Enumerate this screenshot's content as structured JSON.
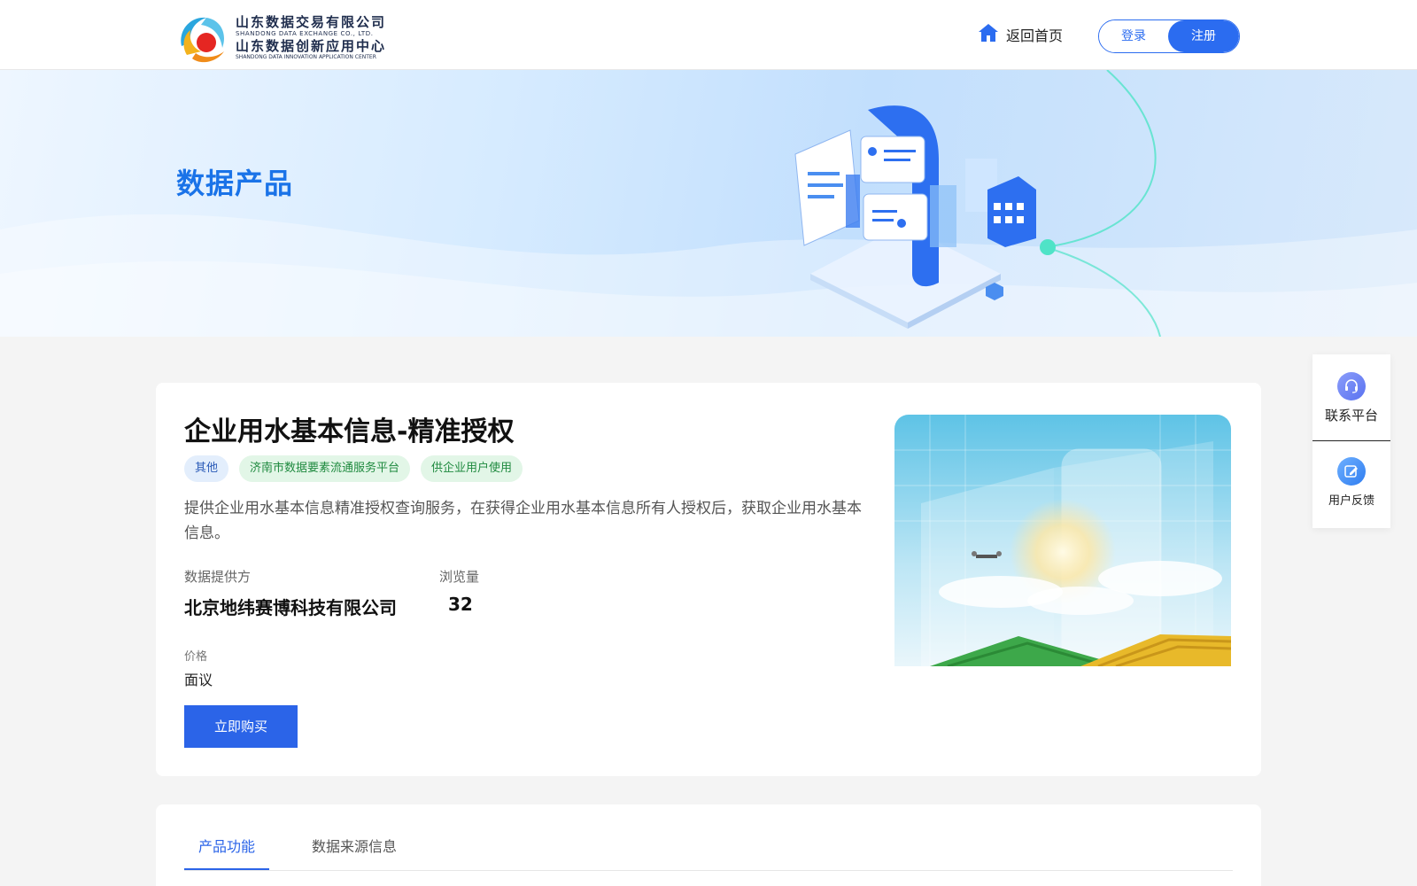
{
  "header": {
    "logo": {
      "line1_cn": "山东数据交易有限公司",
      "line1_en": "SHANDONG DATA EXCHANGE CO., LTD.",
      "line2_cn": "山东数据创新应用中心",
      "line2_en": "SHANDONG DATA INNOVATION APPLICATION CENTER"
    },
    "home_label": "返回首页",
    "login_label": "登录",
    "register_label": "注册"
  },
  "banner": {
    "title": "数据产品"
  },
  "product": {
    "title": "企业用水基本信息-精准授权",
    "tags": [
      {
        "label": "其他",
        "color": "blue"
      },
      {
        "label": "济南市数据要素流通服务平台",
        "color": "green"
      },
      {
        "label": "供企业用户使用",
        "color": "green"
      }
    ],
    "description": "提供企业用水基本信息精准授权查询服务，在获得企业用水基本信息所有人授权后，获取企业用水基本信息。",
    "provider_label": "数据提供方",
    "provider_value": "北京地纬赛博科技有限公司",
    "views_label": "浏览量",
    "views_value": "32",
    "price_label": "价格",
    "price_value": "面议",
    "buy_label": "立即购买"
  },
  "tabs": [
    {
      "label": "产品功能",
      "active": true
    },
    {
      "label": "数据来源信息",
      "active": false
    }
  ],
  "side_panel": {
    "contact_label": "联系平台",
    "feedback_label": "用户反馈"
  },
  "colors": {
    "primary": "#2b64e8",
    "banner_title": "#1a73e8",
    "tag_blue_bg": "#e3eefc",
    "tag_green_bg": "#e2f6e7"
  }
}
